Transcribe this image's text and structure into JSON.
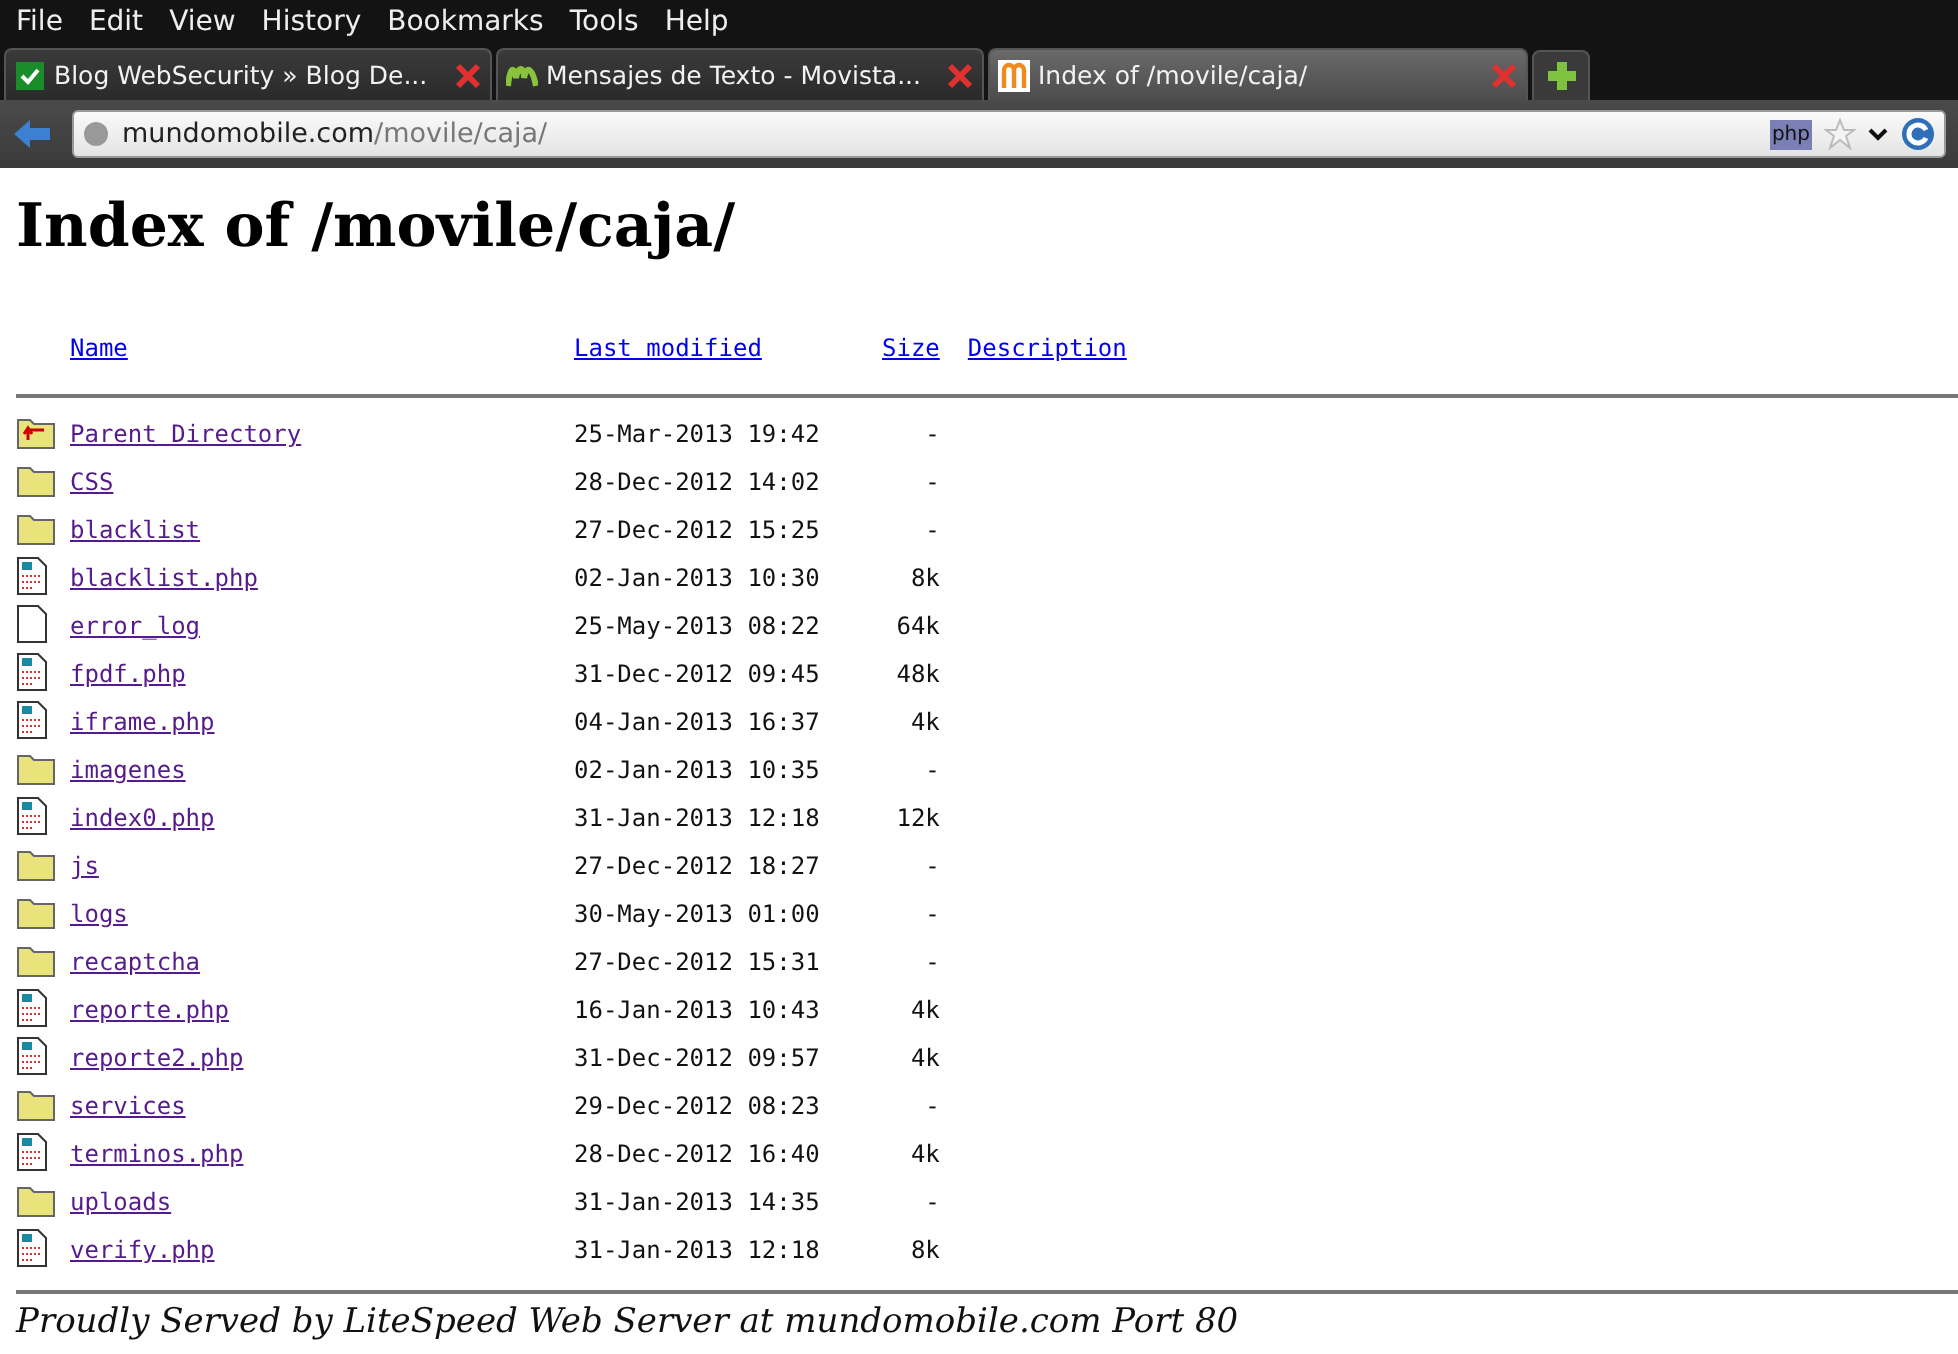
{
  "menu": [
    "File",
    "Edit",
    "View",
    "History",
    "Bookmarks",
    "Tools",
    "Help"
  ],
  "tabs": [
    {
      "title": "Blog WebSecurity » Blog De...",
      "kind": "shield",
      "selected": false
    },
    {
      "title": "Mensajes de Texto - Movista...",
      "kind": "m-green",
      "selected": false
    },
    {
      "title": "Index of /movile/caja/",
      "kind": "m-orange",
      "selected": true
    }
  ],
  "address": {
    "host": "mundomobile.com",
    "path": "/movile/caja/"
  },
  "page": {
    "title": "Index of /movile/caja/",
    "columns": [
      "Name",
      "Last modified",
      "Size",
      "Description"
    ],
    "rows": [
      {
        "kind": "parent",
        "name": "Parent Directory",
        "modified": "25-Mar-2013 19:42",
        "size": "-"
      },
      {
        "kind": "folder",
        "name": "CSS",
        "modified": "28-Dec-2012 14:02",
        "size": "-"
      },
      {
        "kind": "folder",
        "name": "blacklist",
        "modified": "27-Dec-2012 15:25",
        "size": "-"
      },
      {
        "kind": "script",
        "name": "blacklist.php",
        "modified": "02-Jan-2013 10:30",
        "size": "8k"
      },
      {
        "kind": "file",
        "name": "error_log",
        "modified": "25-May-2013 08:22",
        "size": "64k"
      },
      {
        "kind": "script",
        "name": "fpdf.php",
        "modified": "31-Dec-2012 09:45",
        "size": "48k"
      },
      {
        "kind": "script",
        "name": "iframe.php",
        "modified": "04-Jan-2013 16:37",
        "size": "4k"
      },
      {
        "kind": "folder",
        "name": "imagenes",
        "modified": "02-Jan-2013 10:35",
        "size": "-"
      },
      {
        "kind": "script",
        "name": "index0.php",
        "modified": "31-Jan-2013 12:18",
        "size": "12k"
      },
      {
        "kind": "folder",
        "name": "js",
        "modified": "27-Dec-2012 18:27",
        "size": "-"
      },
      {
        "kind": "folder",
        "name": "logs",
        "modified": "30-May-2013 01:00",
        "size": "-"
      },
      {
        "kind": "folder",
        "name": "recaptcha",
        "modified": "27-Dec-2012 15:31",
        "size": "-"
      },
      {
        "kind": "script",
        "name": "reporte.php",
        "modified": "16-Jan-2013 10:43",
        "size": "4k"
      },
      {
        "kind": "script",
        "name": "reporte2.php",
        "modified": "31-Dec-2012 09:57",
        "size": "4k"
      },
      {
        "kind": "folder",
        "name": "services",
        "modified": "29-Dec-2012 08:23",
        "size": "-"
      },
      {
        "kind": "script",
        "name": "terminos.php",
        "modified": "28-Dec-2012 16:40",
        "size": "4k"
      },
      {
        "kind": "folder",
        "name": "uploads",
        "modified": "31-Jan-2013 14:35",
        "size": "-"
      },
      {
        "kind": "script",
        "name": "verify.php",
        "modified": "31-Jan-2013 12:18",
        "size": "8k"
      }
    ],
    "footer": "Proudly Served by LiteSpeed Web Server at mundomobile.com Port 80"
  },
  "php_badge": "php"
}
